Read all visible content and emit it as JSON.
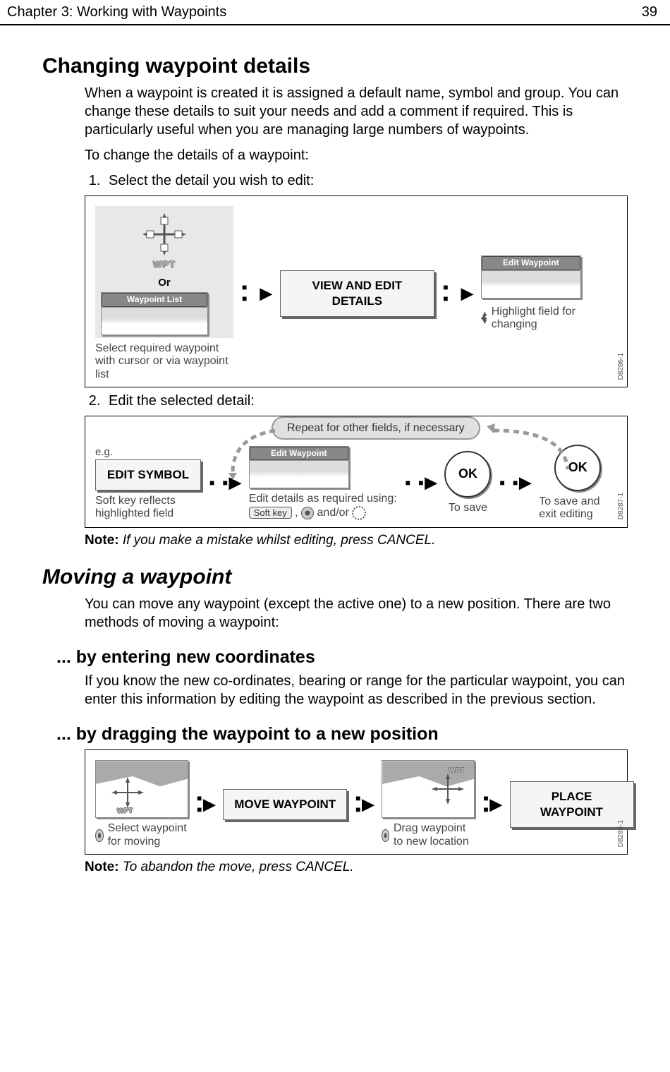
{
  "header": {
    "chapter": "Chapter 3: Working with Waypoints",
    "page": "39"
  },
  "s1": {
    "title": "Changing waypoint details",
    "p1": "When a waypoint is created it is assigned a default name, symbol and group. You can change these details to suit your needs and add a comment if required. This is particularly useful when you are managing large numbers of waypoints.",
    "p2": "To change the details of a waypoint:",
    "step1": "Select the detail you wish to edit:",
    "step2": "Edit the selected detail:"
  },
  "fig1": {
    "wpt": "WPT",
    "or": "Or",
    "wpt_list": "Waypoint List",
    "select_caption": "Select required waypoint with cursor or via waypoint list",
    "view_edit": "VIEW AND EDIT DETAILS",
    "edit_wpt": "Edit Waypoint",
    "highlight": "Highlight field for changing",
    "code": "D8286-1"
  },
  "fig2": {
    "eg": "e.g.",
    "edit_symbol": "EDIT SYMBOL",
    "softkey_caption": "Soft key reflects highlighted field",
    "repeat": "Repeat for other fields, if necessary",
    "edit_wpt": "Edit Waypoint",
    "edit_details": "Edit details as required using:",
    "soft_key": "Soft key",
    "and_or": "and/or",
    "ok1": "OK",
    "ok2": "OK",
    "to_save": "To save",
    "to_save_exit": "To save and exit editing",
    "code": "D8287-1"
  },
  "note1": {
    "label": "Note:",
    "text": "If you make a mistake whilst editing, press CANCEL."
  },
  "s2": {
    "title": "Moving a waypoint",
    "p1": "You can move any waypoint (except the active one) to a new position. There are two methods of moving a waypoint:",
    "sub1": "... by entering new coordinates",
    "sub1_p": "If you know the new co-ordinates, bearing or range for the particular waypoint, you can enter this information by editing the waypoint as described in the previous section.",
    "sub2": "... by dragging the waypoint to a new position"
  },
  "fig3": {
    "wpt": "WPT",
    "select": "Select waypoint for moving",
    "move": "MOVE WAYPOINT",
    "drag": "Drag waypoint to new location",
    "place": "PLACE WAYPOINT",
    "code": "D8288-1"
  },
  "note2": {
    "label": "Note:",
    "text": "To abandon the move, press CANCEL."
  }
}
